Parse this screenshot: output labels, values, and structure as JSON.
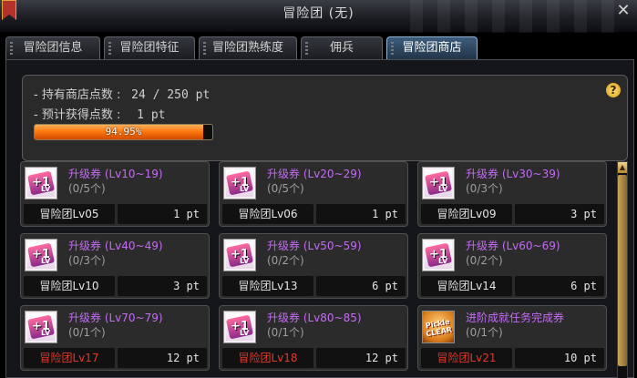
{
  "window": {
    "title": "冒险团 (无)",
    "close_glyph": "✕"
  },
  "tabs": [
    {
      "label": "冒险团信息",
      "active": false
    },
    {
      "label": "冒险团特征",
      "active": false
    },
    {
      "label": "冒险团熟练度",
      "active": false
    },
    {
      "label": "佣兵",
      "active": false
    },
    {
      "label": "冒险团商店",
      "active": true
    }
  ],
  "shop_info": {
    "points_label": "- 持有商店点数 :",
    "points_value": "24 / 250 pt",
    "expected_label": "- 预计获得点数 :",
    "expected_value": "1 pt",
    "progress_text": "94.95%",
    "progress_fraction": 0.9495,
    "help_glyph": "?"
  },
  "items": [
    {
      "icon": "level-up-ticket-icon",
      "name": "升级券 (Lv10~19)",
      "count": "(0/5个)",
      "requirement": "冒险团Lv05",
      "locked": false,
      "price": "1 pt"
    },
    {
      "icon": "level-up-ticket-icon",
      "name": "升级券 (Lv20~29)",
      "count": "(0/5个)",
      "requirement": "冒险团Lv06",
      "locked": false,
      "price": "1 pt"
    },
    {
      "icon": "level-up-ticket-icon",
      "name": "升级券 (Lv30~39)",
      "count": "(0/3个)",
      "requirement": "冒险团Lv09",
      "locked": false,
      "price": "3 pt"
    },
    {
      "icon": "level-up-ticket-icon",
      "name": "升级券 (Lv40~49)",
      "count": "(0/3个)",
      "requirement": "冒险团Lv10",
      "locked": false,
      "price": "3 pt"
    },
    {
      "icon": "level-up-ticket-icon",
      "name": "升级券 (Lv50~59)",
      "count": "(0/2个)",
      "requirement": "冒险团Lv13",
      "locked": false,
      "price": "6 pt"
    },
    {
      "icon": "level-up-ticket-icon",
      "name": "升级券 (Lv60~69)",
      "count": "(0/2个)",
      "requirement": "冒险团Lv14",
      "locked": false,
      "price": "6 pt"
    },
    {
      "icon": "level-up-ticket-icon",
      "name": "升级券 (Lv70~79)",
      "count": "(0/1个)",
      "requirement": "冒险团Lv17",
      "locked": true,
      "price": "12 pt"
    },
    {
      "icon": "level-up-ticket-icon",
      "name": "升级券 (Lv80~85)",
      "count": "(0/1个)",
      "requirement": "冒险团Lv18",
      "locked": true,
      "price": "12 pt"
    },
    {
      "icon": "quest-clear-ticket-icon",
      "name": "进阶成就任务完成券",
      "count": "(0/1个)",
      "requirement": "冒险团Lv21",
      "locked": true,
      "price": "10 pt"
    }
  ],
  "icon_text": {
    "ticket_number": "+1",
    "ticket_suffix": "LV",
    "quest_label": "Pickle CLEAR"
  },
  "colors": {
    "item_name": "#c36cf2",
    "locked_requirement": "#e0392c",
    "active_tab": "#3d5d7c",
    "progress_fill": "#ff7a10"
  }
}
